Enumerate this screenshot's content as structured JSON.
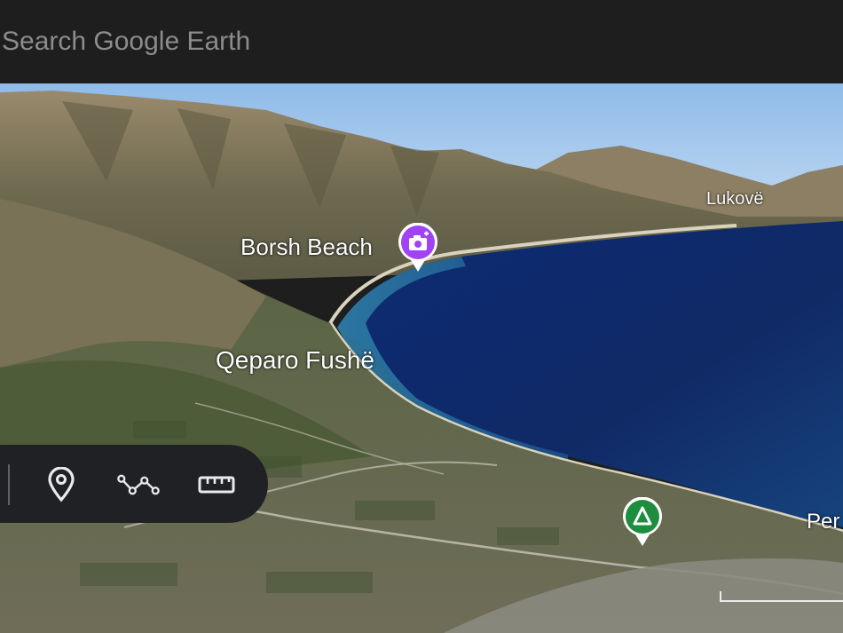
{
  "search": {
    "placeholder": "Search Google Earth"
  },
  "map": {
    "labels": {
      "borsh_beach": "Borsh Beach",
      "qeparo_fushe": "Qeparo Fushë",
      "lukove": "Lukovë",
      "per_partial": "Per"
    },
    "markers": [
      {
        "name": "photo-place-marker",
        "icon": "camera-plus-icon",
        "color": "#a142f4"
      },
      {
        "name": "campground-marker",
        "icon": "campground-icon",
        "color": "#1e8e3e"
      }
    ]
  },
  "toolbar": {
    "tools": [
      {
        "name": "add-placemark-button",
        "icon": "location-pin-icon"
      },
      {
        "name": "draw-path-button",
        "icon": "path-icon"
      },
      {
        "name": "measure-button",
        "icon": "ruler-icon"
      }
    ]
  },
  "colors": {
    "topbar": "#1e1e1e",
    "toolbar": "#202124",
    "sea": "#0f2a6e",
    "sky": "#9ec6ef"
  }
}
